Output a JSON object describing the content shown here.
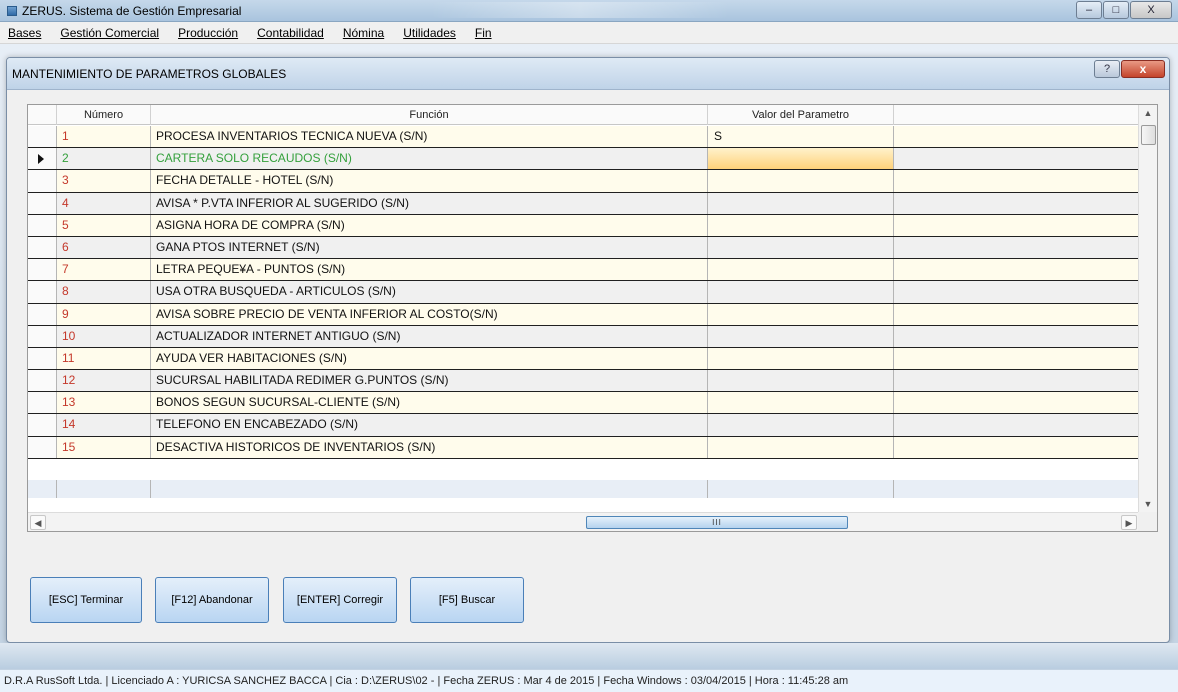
{
  "window": {
    "title": "ZERUS. Sistema de Gestión Empresarial",
    "controls": {
      "minimize": "–",
      "maximize": "□",
      "close": "X"
    }
  },
  "menubar": {
    "items": [
      "Bases",
      "Gestión Comercial",
      "Producción",
      "Contabilidad",
      "Nómina",
      "Utilidades",
      "Fin"
    ]
  },
  "dialog": {
    "title": "MANTENIMIENTO DE PARAMETROS GLOBALES",
    "help_label": "?",
    "close_label": "x"
  },
  "grid": {
    "columns": [
      "",
      "Número",
      "Función",
      "Valor del Parametro",
      ""
    ],
    "selected_row": 2,
    "rows": [
      {
        "numero": "1",
        "funcion": "PROCESA INVENTARIOS TECNICA NUEVA (S/N)",
        "valor": "S"
      },
      {
        "numero": "2",
        "funcion": "CARTERA SOLO RECAUDOS (S/N)",
        "valor": ""
      },
      {
        "numero": "3",
        "funcion": "FECHA DETALLE - HOTEL (S/N)",
        "valor": ""
      },
      {
        "numero": "4",
        "funcion": "AVISA * P.VTA INFERIOR AL SUGERIDO (S/N)",
        "valor": ""
      },
      {
        "numero": "5",
        "funcion": "ASIGNA HORA DE COMPRA (S/N)",
        "valor": ""
      },
      {
        "numero": "6",
        "funcion": "GANA PTOS INTERNET (S/N)",
        "valor": ""
      },
      {
        "numero": "7",
        "funcion": "LETRA PEQUE¥A - PUNTOS (S/N)",
        "valor": ""
      },
      {
        "numero": "8",
        "funcion": "USA OTRA BUSQUEDA - ARTICULOS (S/N)",
        "valor": ""
      },
      {
        "numero": "9",
        "funcion": "AVISA SOBRE PRECIO DE VENTA INFERIOR AL COSTO(S/N)",
        "valor": ""
      },
      {
        "numero": "10",
        "funcion": "ACTUALIZADOR INTERNET ANTIGUO (S/N)",
        "valor": ""
      },
      {
        "numero": "11",
        "funcion": "AYUDA VER HABITACIONES (S/N)",
        "valor": ""
      },
      {
        "numero": "12",
        "funcion": "SUCURSAL HABILITADA REDIMER G.PUNTOS (S/N)",
        "valor": ""
      },
      {
        "numero": "13",
        "funcion": "BONOS SEGUN SUCURSAL-CLIENTE (S/N)",
        "valor": ""
      },
      {
        "numero": "14",
        "funcion": "TELEFONO EN ENCABEZADO (S/N)",
        "valor": ""
      },
      {
        "numero": "15",
        "funcion": "DESACTIVA HISTORICOS DE INVENTARIOS (S/N)",
        "valor": ""
      }
    ],
    "hscroll_thumb_label": "III"
  },
  "buttons": {
    "terminar": "[ESC] Terminar",
    "abandonar": "[F12] Abandonar",
    "corregir": "[ENTER] Corregir",
    "buscar": "[F5] Buscar"
  },
  "statusbar": {
    "text": "D.R.A RusSoft Ltda. | Licenciado A : YURICSA SANCHEZ BACCA  | Cia : D:\\ZERUS\\02 -  | Fecha ZERUS : Mar 4 de 2015 | Fecha Windows : 03/04/2015  | Hora  : 11:45:28 am"
  },
  "colors": {
    "number_red": "#c4382a",
    "selected_green": "#34a03c",
    "row_cream": "#fffcec",
    "row_grey": "#f0f0f0",
    "button_blue": "#b9d5f2"
  }
}
